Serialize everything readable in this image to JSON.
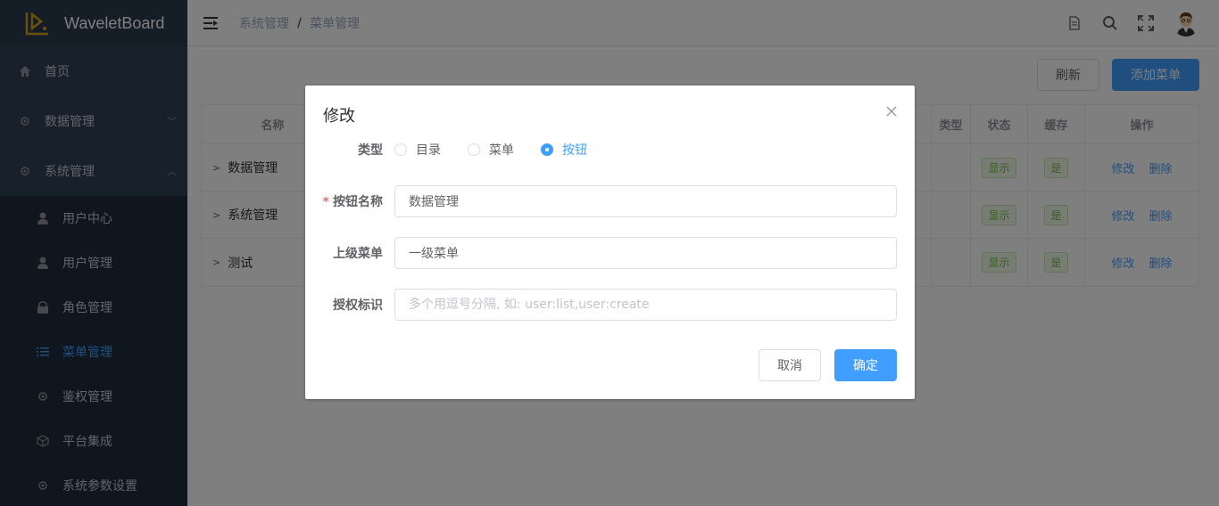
{
  "app": {
    "title": "WaveletBoard"
  },
  "sidebar": {
    "items": [
      {
        "label": "首页",
        "icon": "home-icon"
      },
      {
        "label": "数据管理",
        "icon": "gear-icon"
      },
      {
        "label": "系统管理",
        "icon": "gear-icon"
      }
    ],
    "subitems": [
      {
        "label": "用户中心",
        "icon": "user-icon"
      },
      {
        "label": "用户管理",
        "icon": "user-icon"
      },
      {
        "label": "角色管理",
        "icon": "lock-icon"
      },
      {
        "label": "菜单管理",
        "icon": "list-icon"
      },
      {
        "label": "鉴权管理",
        "icon": "gear-icon"
      },
      {
        "label": "平台集成",
        "icon": "cube-icon"
      },
      {
        "label": "系统参数设置",
        "icon": "gear-icon"
      }
    ]
  },
  "breadcrumb": {
    "parent": "系统管理",
    "separator": "/",
    "current": "菜单管理"
  },
  "toolbar": {
    "refresh_label": "刷新",
    "add_label": "添加菜单"
  },
  "table": {
    "headers": {
      "name": "名称",
      "type": "类型",
      "status": "状态",
      "cache": "缓存",
      "ops": "操作"
    },
    "rows": [
      {
        "name": "数据管理",
        "status": "显示",
        "cache": "是",
        "edit": "修改",
        "delete": "删除"
      },
      {
        "name": "系统管理",
        "status": "显示",
        "cache": "是",
        "edit": "修改",
        "delete": "删除"
      },
      {
        "name": "测试",
        "status": "显示",
        "cache": "是",
        "edit": "修改",
        "delete": "删除"
      }
    ]
  },
  "dialog": {
    "title": "修改",
    "type_label": "类型",
    "type_options": [
      "目录",
      "菜单",
      "按钮"
    ],
    "type_selected": "按钮",
    "name_label": "按钮名称",
    "name_value": "数据管理",
    "parent_label": "上级菜单",
    "parent_value": "一级菜单",
    "perm_label": "授权标识",
    "perm_placeholder": "多个用逗号分隔, 如: user:list,user:create",
    "cancel_label": "取消",
    "ok_label": "确定"
  },
  "colors": {
    "primary": "#409eff",
    "sidebar": "#304156",
    "success": "#67c23a"
  }
}
